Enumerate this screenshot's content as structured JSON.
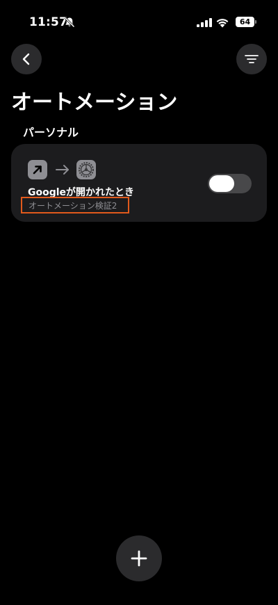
{
  "status_bar": {
    "time": "11:57",
    "battery": "64",
    "icons": [
      "bell-slash-icon",
      "cellular-signal-icon",
      "wifi-icon",
      "battery-icon"
    ]
  },
  "nav": {
    "back_icon": "chevron-left-icon",
    "filter_icon": "filter-lines-icon"
  },
  "page_title": "オートメーション",
  "section": {
    "header": "パーソナル"
  },
  "automation": {
    "trigger_icon": "open-app-arrow-icon",
    "action_icon": "settings-gear-icon",
    "title": "Googleが開かれたとき",
    "subtitle": "オートメーション検証2",
    "enabled": true,
    "highlight_color": "#e25a1c"
  },
  "add_button_icon": "plus-icon",
  "colors": {
    "background": "#000000",
    "card": "#1c1c1e",
    "button": "#2b2b2d",
    "secondary_text": "#8e8e93"
  }
}
